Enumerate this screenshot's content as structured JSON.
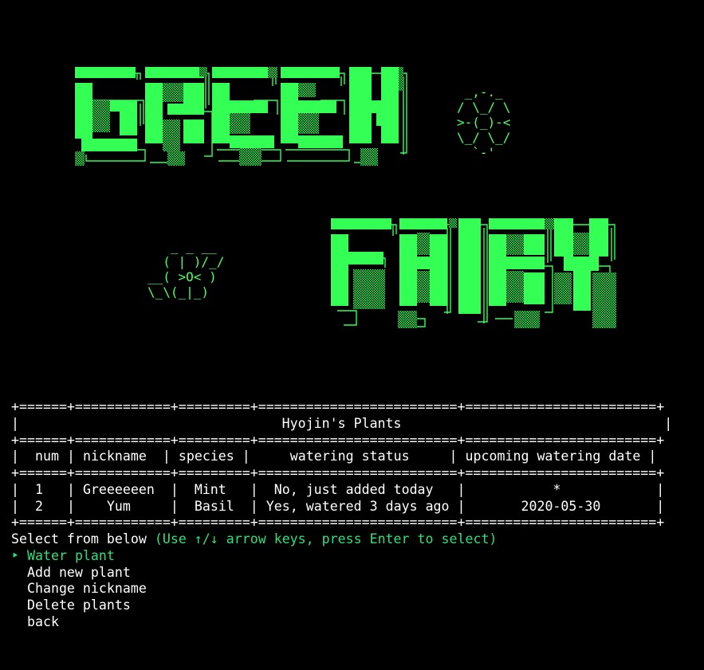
{
  "table": {
    "title": "Hyojin's Plants",
    "headers": [
      "num",
      "nickname",
      "species",
      "watering status",
      "upcoming watering date"
    ],
    "rows": [
      [
        "1",
        "Greeeeeen",
        "Mint",
        "No, just added today",
        "*"
      ],
      [
        "2",
        "Yum",
        "Basil",
        "Yes, watered 3 days ago",
        "2020-05-30"
      ]
    ]
  },
  "prompt": {
    "label": "Select from below",
    "hint": "(Use ↑/↓ arrow keys, press Enter to select)",
    "pointer": "‣"
  },
  "menu": {
    "selected_index": 0,
    "items": [
      "Water plant",
      "Add new plant",
      "Change nickname",
      "Delete plants",
      "back"
    ]
  },
  "art": {
    "flower_top": " _,-._\n/ \\_/ \\\n>-(_)-<\n\\_/ \\_/\n  `-'",
    "bug": "   _ _ __\n  ( | )/_/\n__( >O< )\n\\_\\(_|_)"
  },
  "colors": {
    "terminal_bg": "#000000",
    "text": "#ffffff",
    "accent": "#2de07a",
    "block": "#33ff55",
    "ascii_green": "#4dff66"
  }
}
